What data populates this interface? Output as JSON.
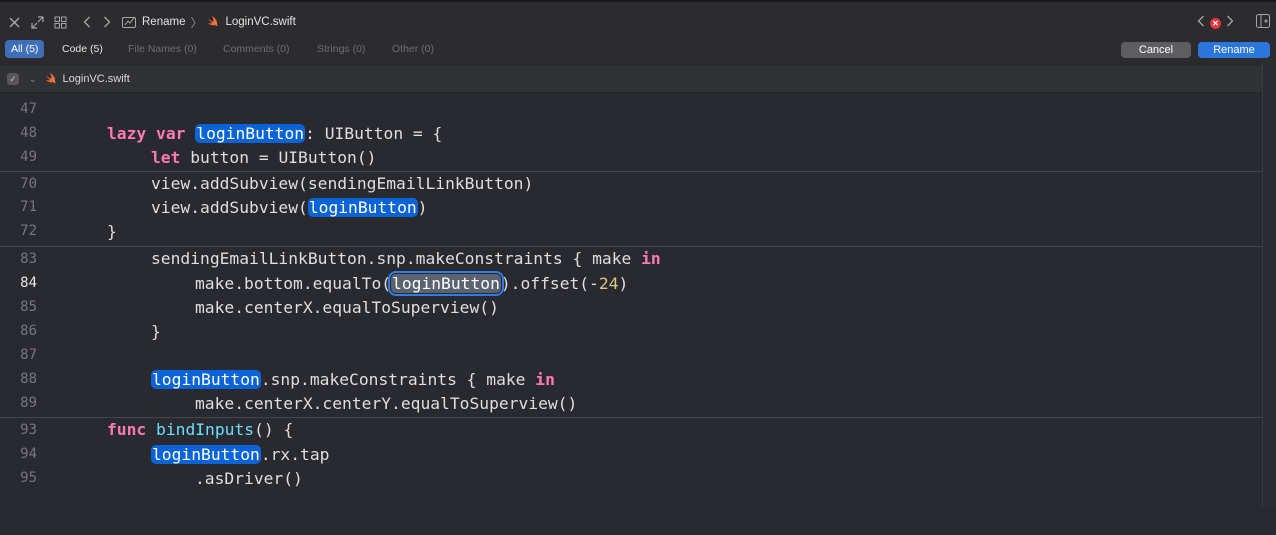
{
  "toolbar": {
    "breadcrumbs": [
      "Rename",
      "LoginVC.swift"
    ],
    "icons": [
      "close-icon",
      "expand-icon",
      "grid-icon",
      "back-icon",
      "forward-icon",
      "refactor-icon",
      "swift-icon",
      "error-icon",
      "split-editor-icon"
    ]
  },
  "filters": {
    "all": "All (5)",
    "code": "Code (5)",
    "file_names": "File Names (0)",
    "comments": "Comments (0)",
    "strings": "Strings (0)",
    "other": "Other (0)"
  },
  "buttons": {
    "cancel": "Cancel",
    "rename": "Rename"
  },
  "file": {
    "name": "LoginVC.swift"
  },
  "lines": [
    {
      "n": "47",
      "text": ""
    },
    {
      "n": "48",
      "text": "lazy var loginButton: UIButton = {"
    },
    {
      "n": "49",
      "text": "let button = UIButton()"
    },
    {
      "n": "70",
      "text": "view.addSubview(sendingEmailLinkButton)"
    },
    {
      "n": "71",
      "text": "view.addSubview(loginButton)"
    },
    {
      "n": "72",
      "text": "}"
    },
    {
      "n": "83",
      "text": "sendingEmailLinkButton.snp.makeConstraints { make in"
    },
    {
      "n": "84",
      "text": "make.bottom.equalTo(loginButton).offset(-24)"
    },
    {
      "n": "85",
      "text": "make.centerX.equalToSuperview()"
    },
    {
      "n": "86",
      "text": "}"
    },
    {
      "n": "87",
      "text": ""
    },
    {
      "n": "88",
      "text": "loginButton.snp.makeConstraints { make in"
    },
    {
      "n": "89",
      "text": "make.centerX.centerY.equalToSuperview()"
    },
    {
      "n": "93",
      "text": "func bindInputs() {"
    },
    {
      "n": "94",
      "text": "loginButton.rx.tap"
    },
    {
      "n": "95",
      "text": ".asDriver()"
    }
  ],
  "colors": {
    "keyword": "#ff7ab2",
    "function": "#6bdfff",
    "match": "#0a64d8",
    "accent": "#2b76dd"
  }
}
